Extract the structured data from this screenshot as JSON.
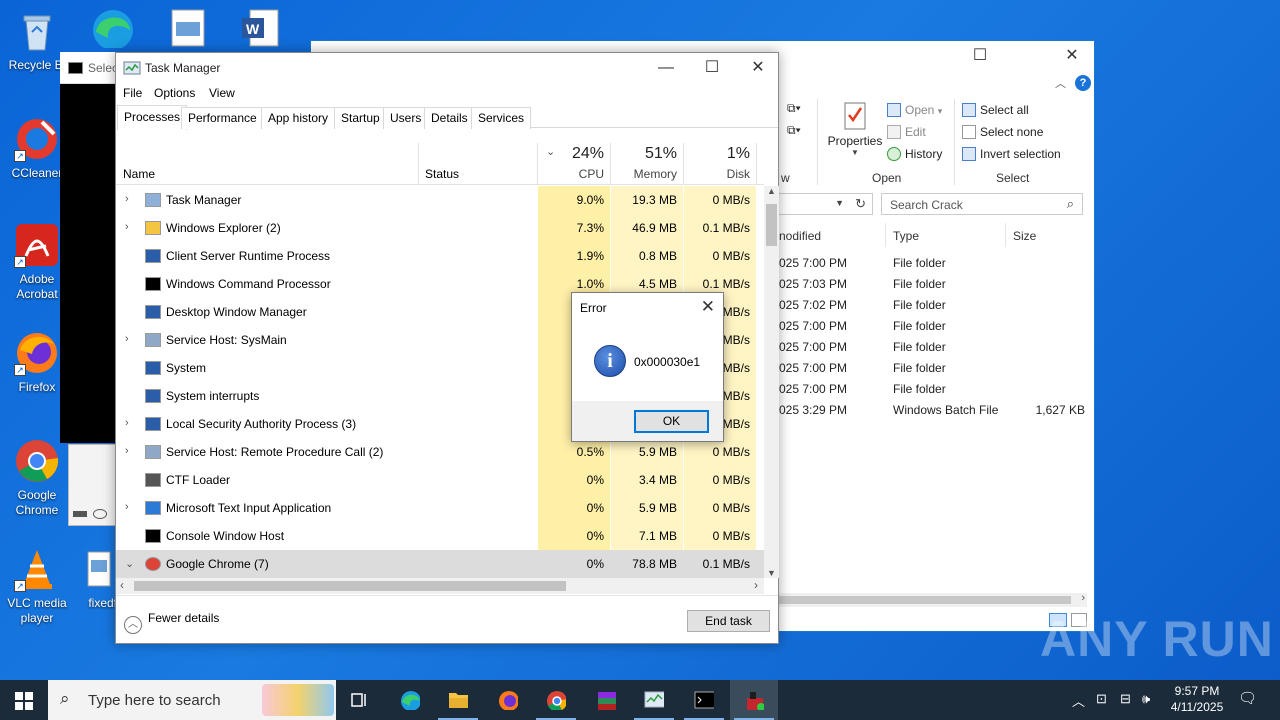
{
  "desktop": {
    "icons": [
      {
        "label": "Recycle Bin",
        "display": "Recycle Bi"
      },
      {
        "label": "CCleaner",
        "display": "CCleaner"
      },
      {
        "label": "Adobe Acrobat",
        "line1": "Adobe",
        "line2": "Acrobat"
      },
      {
        "label": "Firefox",
        "display": "Firefox"
      },
      {
        "label": "Google Chrome",
        "line1": "Google",
        "line2": "Chrome"
      },
      {
        "label": "VLC media player",
        "line1": "VLC media",
        "line2": "player"
      },
      {
        "label": "fixedfu",
        "display": "fixedfu"
      }
    ],
    "console_title": "Selec"
  },
  "explorer": {
    "ribbon": {
      "properties": "Properties",
      "open": "Open",
      "edit": "Edit",
      "history": "History",
      "select_all": "Select all",
      "select_none": "Select none",
      "invert_selection": "Invert selection",
      "group_view": "w",
      "group_open": "Open",
      "group_select": "Select"
    },
    "search_placeholder": "Search Crack",
    "columns": {
      "modified": "nodified",
      "type": "Type",
      "size": "Size"
    },
    "files": [
      {
        "modified": "025 7:00 PM",
        "type": "File folder",
        "size": ""
      },
      {
        "modified": "025 7:03 PM",
        "type": "File folder",
        "size": ""
      },
      {
        "modified": "025 7:02 PM",
        "type": "File folder",
        "size": ""
      },
      {
        "modified": "025 7:00 PM",
        "type": "File folder",
        "size": ""
      },
      {
        "modified": "025 7:00 PM",
        "type": "File folder",
        "size": ""
      },
      {
        "modified": "025 7:00 PM",
        "type": "File folder",
        "size": ""
      },
      {
        "modified": "025 7:00 PM",
        "type": "File folder",
        "size": ""
      },
      {
        "modified": "025 3:29 PM",
        "type": "Windows Batch File",
        "size": "1,627 KB"
      }
    ]
  },
  "taskmgr": {
    "title": "Task Manager",
    "menu": [
      "File",
      "Options",
      "View"
    ],
    "tabs": [
      "Processes",
      "Performance",
      "App history",
      "Startup",
      "Users",
      "Details",
      "Services"
    ],
    "active_tab": "Processes",
    "columns": {
      "name": "Name",
      "status": "Status",
      "cpu_pct": "24%",
      "cpu": "CPU",
      "mem_pct": "51%",
      "mem": "Memory",
      "disk_pct": "1%",
      "disk": "Disk"
    },
    "processes": [
      {
        "name": "Task Manager",
        "expand": true,
        "cpu": "9.0%",
        "mem": "19.3 MB",
        "disk": "0 MB/s"
      },
      {
        "name": "Windows Explorer (2)",
        "expand": true,
        "cpu": "7.3%",
        "mem": "46.9 MB",
        "disk": "0.1 MB/s"
      },
      {
        "name": "Client Server Runtime Process",
        "expand": false,
        "cpu": "1.9%",
        "mem": "0.8 MB",
        "disk": "0 MB/s"
      },
      {
        "name": "Windows Command Processor",
        "expand": false,
        "cpu": "1.0%",
        "mem": "4.5 MB",
        "disk": "0.1 MB/s"
      },
      {
        "name": "Desktop Window Manager",
        "expand": false,
        "cpu": "",
        "mem": "",
        "disk": "MB/s"
      },
      {
        "name": "Service Host: SysMain",
        "expand": true,
        "cpu": "",
        "mem": "",
        "disk": "MB/s"
      },
      {
        "name": "System",
        "expand": false,
        "cpu": "",
        "mem": "",
        "disk": "MB/s"
      },
      {
        "name": "System interrupts",
        "expand": false,
        "cpu": "",
        "mem": "",
        "disk": "MB/s"
      },
      {
        "name": "Local Security Authority Process (3)",
        "expand": true,
        "cpu": "",
        "mem": "",
        "disk": "MB/s"
      },
      {
        "name": "Service Host: Remote Procedure Call (2)",
        "expand": true,
        "cpu": "0.5%",
        "mem": "5.9 MB",
        "disk": "0 MB/s"
      },
      {
        "name": "CTF Loader",
        "expand": false,
        "cpu": "0%",
        "mem": "3.4 MB",
        "disk": "0 MB/s"
      },
      {
        "name": "Microsoft Text Input Application",
        "expand": true,
        "cpu": "0%",
        "mem": "5.9 MB",
        "disk": "0 MB/s"
      },
      {
        "name": "Console Window Host",
        "expand": false,
        "cpu": "0%",
        "mem": "7.1 MB",
        "disk": "0 MB/s"
      },
      {
        "name": "Google Chrome (7)",
        "expand": true,
        "expanded": true,
        "selected": true,
        "cpu": "0%",
        "mem": "78.8 MB",
        "disk": "0.1 MB/s"
      }
    ],
    "fewer_details": "Fewer details",
    "end_task": "End task"
  },
  "error_dialog": {
    "title": "Error",
    "message": "0x000030e1",
    "ok": "OK"
  },
  "watermark": "ANY RUN",
  "taskbar": {
    "search_placeholder": "Type here to search",
    "time": "9:57 PM",
    "date": "4/11/2025"
  },
  "colors": {
    "desktop": "#0a64d6",
    "cpu_heat": "#fff0a8",
    "heat": "#fff4c4",
    "taskbar": "#1c2b3a",
    "accent": "#0078d7"
  }
}
